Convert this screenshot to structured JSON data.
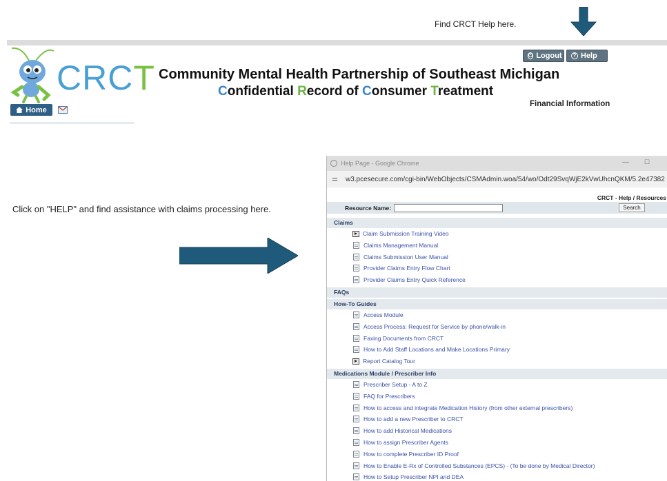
{
  "header": {
    "help_note": "Find CRCT Help here.",
    "logout_label": "Logout",
    "help_label": "Help",
    "logo_text_c": "CRC",
    "logo_text_t": "T",
    "title_line1": "Community Mental Health Partnership of Southeast Michigan",
    "title_line2_parts": [
      "C",
      "onfidential ",
      "R",
      "ecord of ",
      "C",
      "onsumer ",
      "T",
      "reatment"
    ],
    "section_label": "Financial Information",
    "home_label": "Home"
  },
  "instruction": "Click on \"HELP\" and find assistance  with claims processing here.",
  "browser": {
    "window_title": "Help Page - Google Chrome",
    "url": "w3.pcesecure.com/cgi-bin/WebObjects/CSMAdmin.woa/54/wo/Odt29SvqWjE2kVwUhcnQKM/5.2e47382",
    "page_header": "CRCT - Help / Resources",
    "search_label": "Resource Name:",
    "search_value": "",
    "search_button": "Search",
    "sections": [
      {
        "title": "Claims",
        "items": [
          {
            "label": "Claim Submission Training Video",
            "icon": "video-icon"
          },
          {
            "label": "Claims Management Manual",
            "icon": "document-icon"
          },
          {
            "label": "Claims Submission User Manual",
            "icon": "document-icon"
          },
          {
            "label": "Provider Claims Entry Flow Chart",
            "icon": "document-icon"
          },
          {
            "label": "Provider Claims Entry Quick Reference",
            "icon": "document-icon"
          }
        ]
      },
      {
        "title": "FAQs",
        "items": []
      },
      {
        "title": "How-To Guides",
        "items": [
          {
            "label": "Access Module",
            "icon": "document-icon"
          },
          {
            "label": "Access Process: Request for Service by phone/walk-in",
            "icon": "document-icon"
          },
          {
            "label": "Faxing Documents from CRCT",
            "icon": "document-icon"
          },
          {
            "label": "How to Add Staff Locations and Make Locations Primary",
            "icon": "document-icon"
          },
          {
            "label": "Report Catalog Tour",
            "icon": "video-icon"
          }
        ]
      },
      {
        "title": "Medications Module / Prescriber Info",
        "items": [
          {
            "label": "Prescriber Setup - A to Z",
            "icon": "document-icon"
          },
          {
            "label": "FAQ for Prescribers",
            "icon": "document-icon"
          },
          {
            "label": "How to access and integrate Medication History (from other external prescribers)",
            "icon": "document-icon"
          },
          {
            "label": "How to add a new Prescriber to CRCT",
            "icon": "document-icon"
          },
          {
            "label": "How to add Historical Medications",
            "icon": "document-icon"
          },
          {
            "label": "How to assign Prescriber Agents",
            "icon": "document-icon"
          },
          {
            "label": "How to complete Prescriber ID Proof",
            "icon": "document-icon"
          },
          {
            "label": "How to Enable E-Rx of Controlled Substances (EPCS) - (To be done by Medical Director)",
            "icon": "document-icon"
          },
          {
            "label": "How to Setup Prescriber NPI and DEA",
            "icon": "document-icon"
          }
        ]
      }
    ]
  },
  "colors": {
    "arrow": "#1f5a7a",
    "logo_blue": "#4a9fd3",
    "logo_green": "#7ac143",
    "link": "#3a50a6"
  }
}
